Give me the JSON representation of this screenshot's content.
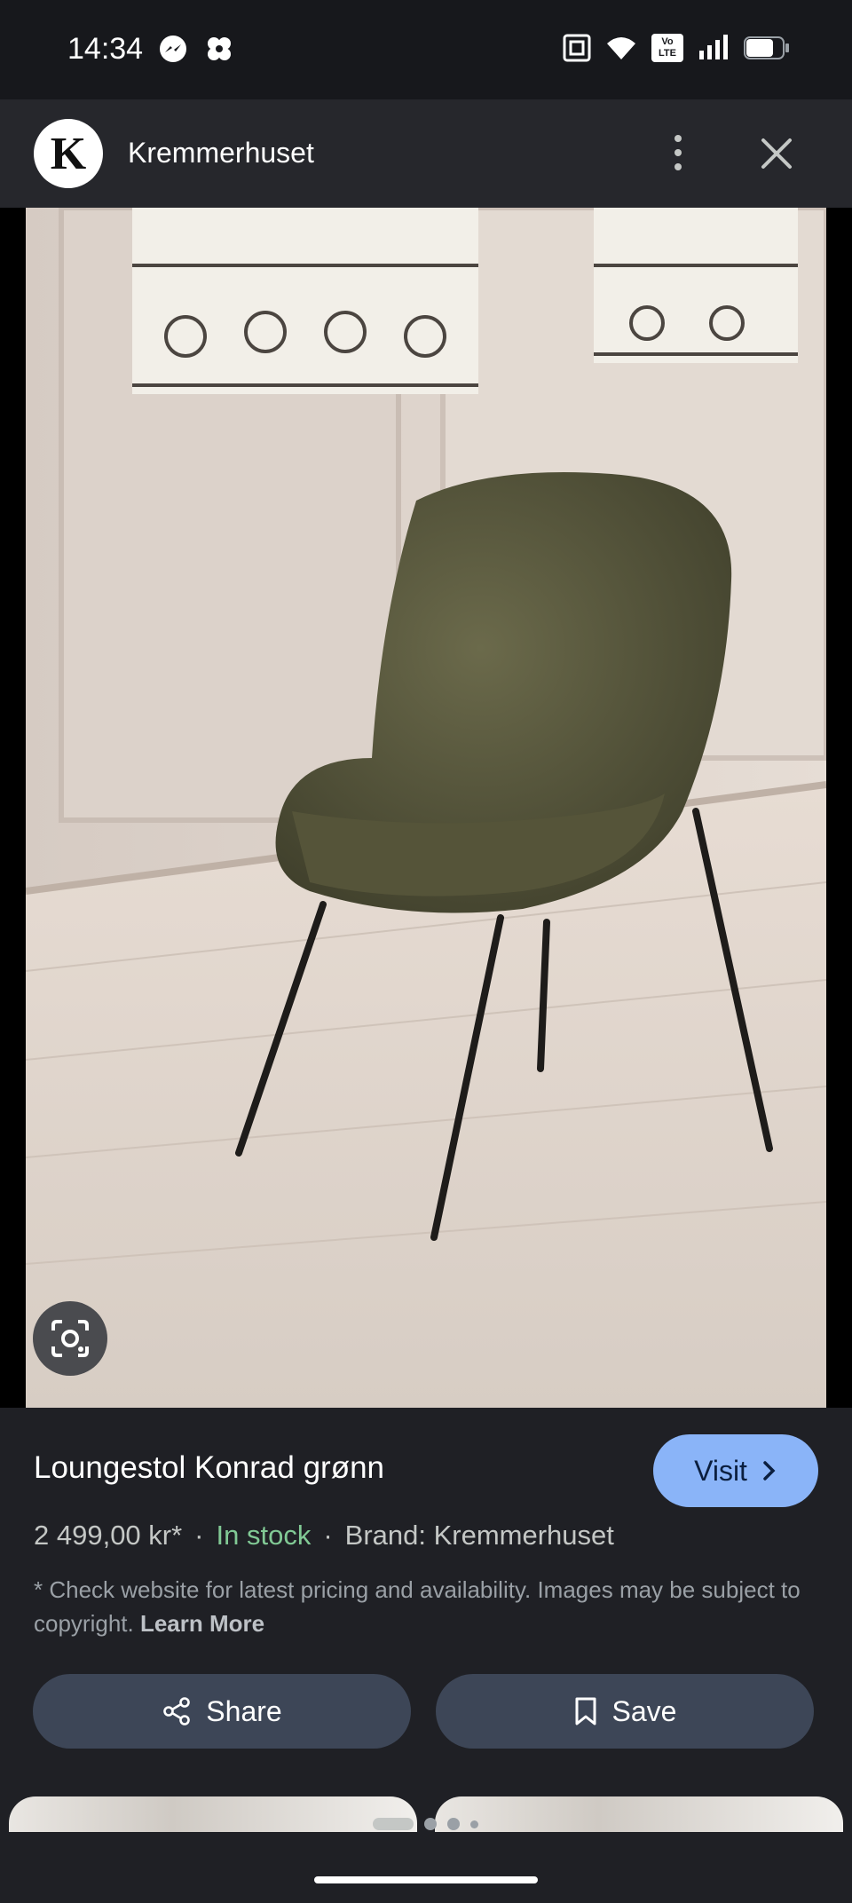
{
  "status_bar": {
    "time": "14:34",
    "icons": [
      "messenger-icon",
      "app-icon",
      "nfc-icon",
      "wifi-icon",
      "volte-icon",
      "signal-icon",
      "battery-icon"
    ],
    "volte_text": "Vo LTE"
  },
  "header": {
    "logo_letter": "K",
    "site_name": "Kremmerhuset"
  },
  "product": {
    "title": "Loungestol Konrad grønn",
    "price": "2 499,00 kr*",
    "stock": "In stock",
    "brand": "Brand: Kremmerhuset",
    "disclaimer": "* Check website for latest pricing and availability. Images may be subject to copyright.",
    "learn_more": "Learn More"
  },
  "buttons": {
    "visit": "Visit",
    "share": "Share",
    "save": "Save"
  },
  "colors": {
    "accent": "#8ab4f8",
    "stock_green": "#81c995",
    "action_button_bg": "#3d4657",
    "background": "#1f2025"
  }
}
